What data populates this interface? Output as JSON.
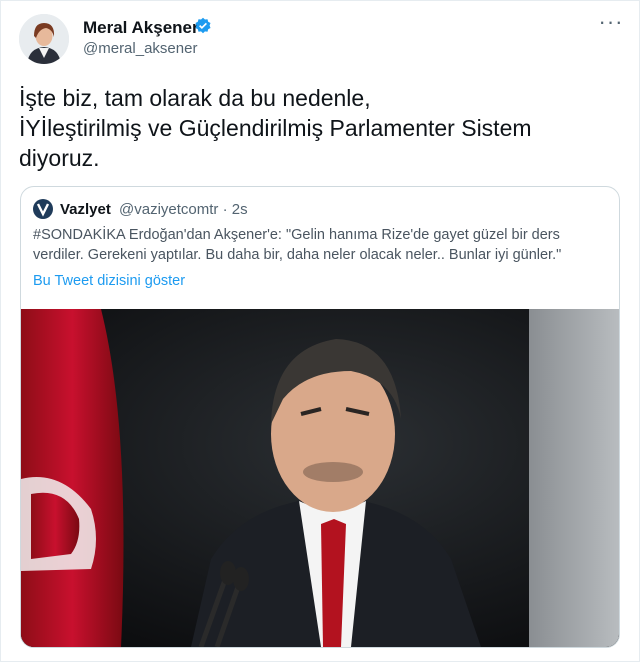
{
  "tweet": {
    "author_name": "Meral Akşener",
    "author_handle": "@meral_aksener",
    "more_icon": "more-dots-icon",
    "verified_icon": "verified-badge-icon",
    "text_lines": [
      "İşte biz, tam olarak da bu nedenle,",
      "İYİleştirilmiş ve Güçlendirilmiş Parlamenter Sistem",
      "diyoruz."
    ]
  },
  "quote": {
    "author_name": "Vazlyet",
    "author_handle": "@vaziyetcomtr · 2s",
    "text_lines": [
      "#SONDAKİKA Erdoğan'dan Akşener'e: \"Gelin hanıma Rize'de gayet güzel bir ders",
      "verdiler. Gerekeni yaptılar. Bu daha bir, daha neler olacak neler.. Bunlar iyi günler.\""
    ],
    "thread_link": "Bu Tweet dizisini göster",
    "colors": {
      "link": "#1d9bf0",
      "flag_red": "#c8102e"
    }
  }
}
